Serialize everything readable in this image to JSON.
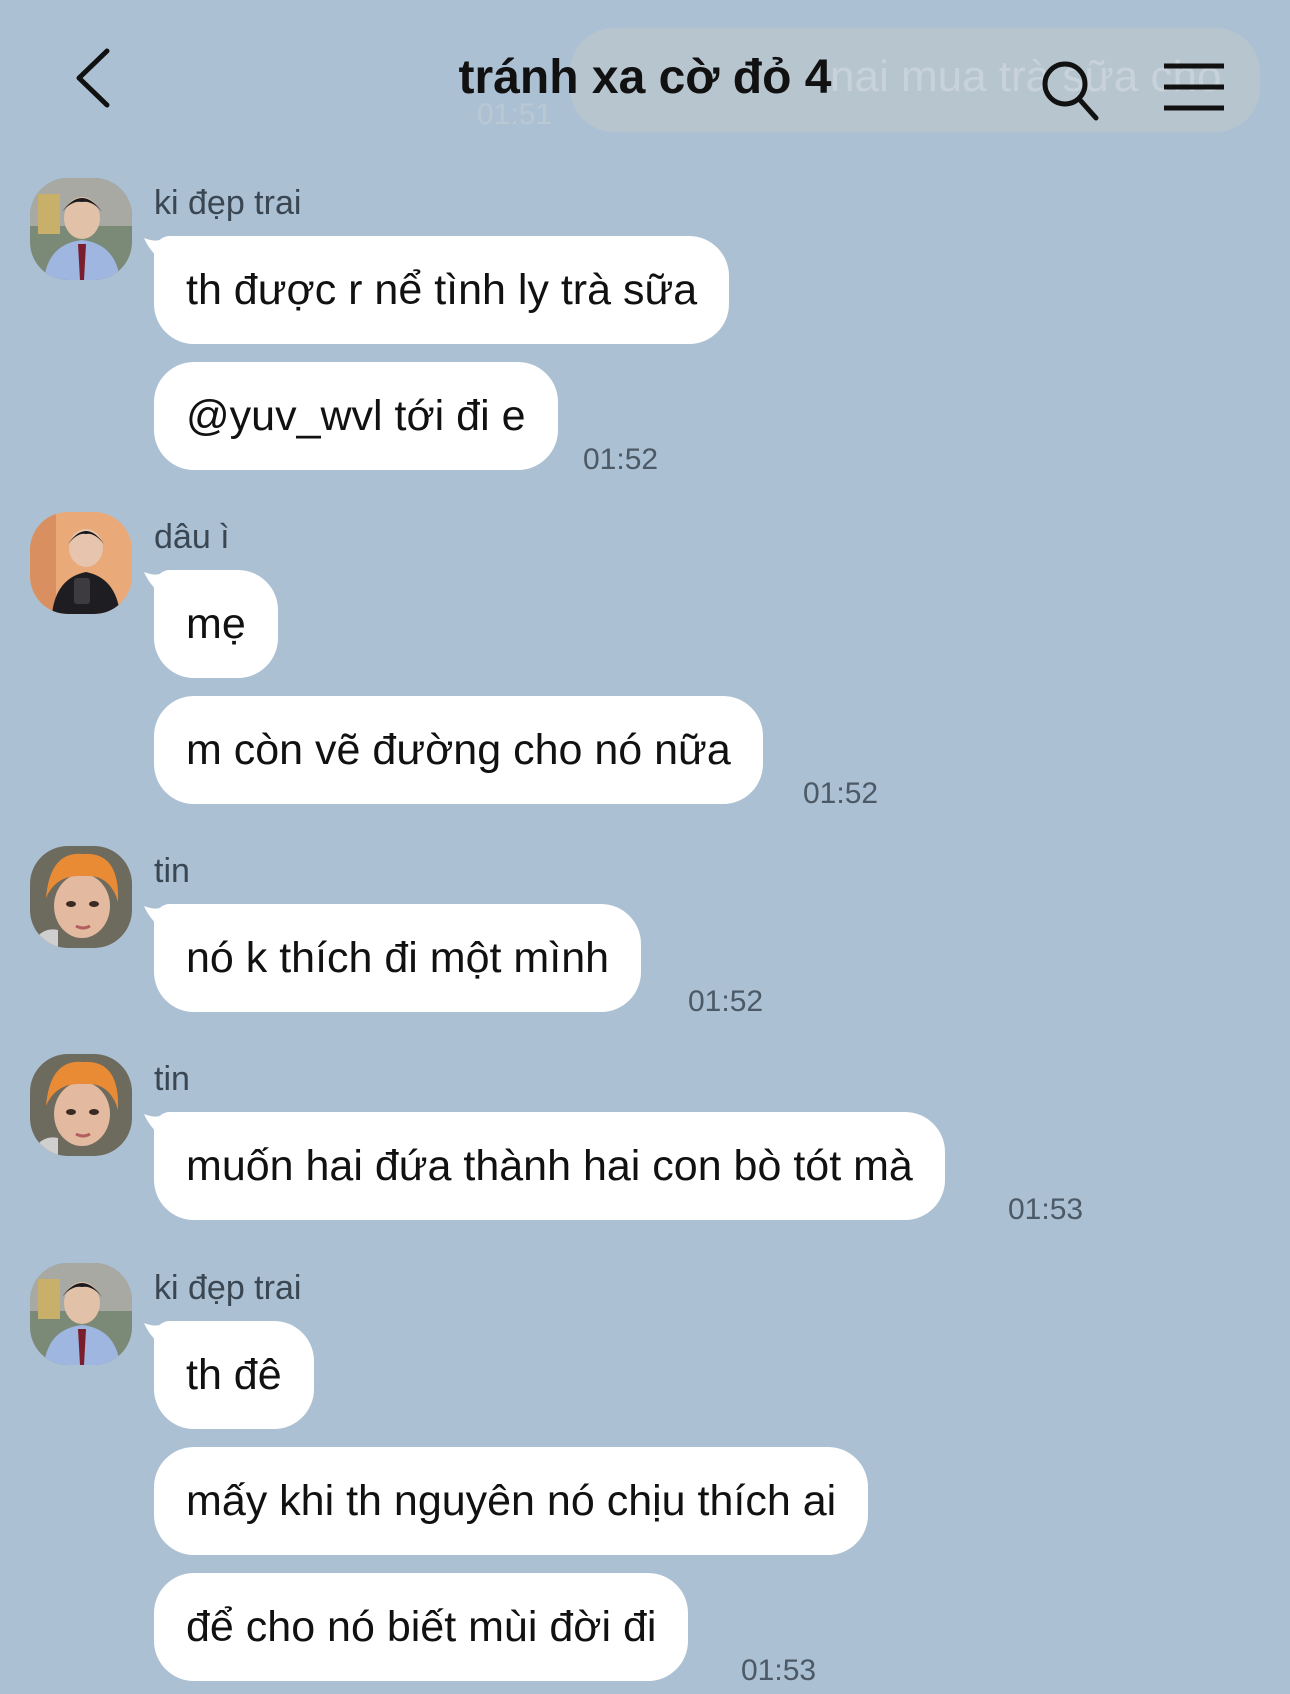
{
  "header": {
    "title": "tránh xa cờ đỏ 4",
    "ghost_preview_text": "nai mua trà sữa cho",
    "ghost_preview_time": "01:51",
    "back_icon": "chevron-left-icon",
    "search_icon": "search-icon",
    "menu_icon": "hamburger-menu-icon"
  },
  "colors": {
    "background": "#acc0d3",
    "bubble": "#ffffff",
    "text": "#111111",
    "meta": "#4c5966"
  },
  "messages": [
    {
      "sender": "ki đẹp trai",
      "avatar": "avatar-ki",
      "bubbles": [
        "th được r nể tình ly trà sữa",
        "@yuv_wvl tới đi e"
      ],
      "time": "01:52"
    },
    {
      "sender": "dâu ì",
      "avatar": "avatar-dau",
      "bubbles": [
        "mẹ",
        "m còn vẽ đường cho nó nữa"
      ],
      "time": "01:52"
    },
    {
      "sender": "tin",
      "avatar": "avatar-tin",
      "bubbles": [
        "nó k thích đi một mình"
      ],
      "time": "01:52"
    },
    {
      "sender": "tin",
      "avatar": "avatar-tin",
      "bubbles": [
        "muốn hai đứa thành hai con bò tót mà"
      ],
      "time": "01:53"
    },
    {
      "sender": "ki đẹp trai",
      "avatar": "avatar-ki",
      "bubbles": [
        "th đê",
        "mấy khi th nguyên nó chịu thích ai",
        "để cho nó biết mùi đời đi"
      ],
      "time": "01:53"
    }
  ]
}
